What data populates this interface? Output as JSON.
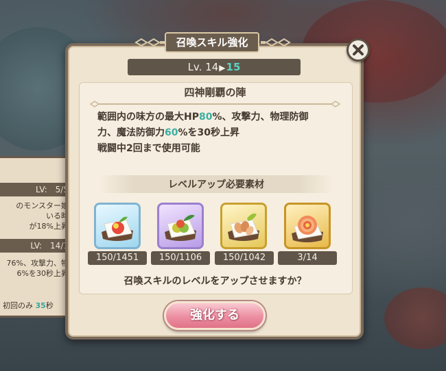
{
  "dialog": {
    "title": "召喚スキル強化",
    "level": {
      "prefix": "Lv.",
      "from": "14",
      "to": "15",
      "arrow": "▶"
    }
  },
  "skill": {
    "name": "四神剛覇の陣",
    "desc_line1_a": "範囲内の味方の最大HP",
    "desc_line1_val": "80",
    "desc_line1_b": "%、攻撃力、物理防御",
    "desc_line2_a": "力、魔法防御力",
    "desc_line2_val": "60",
    "desc_line2_b": "%を30秒上昇",
    "desc_line3": "戦闘中2回まで使用可能"
  },
  "materials": {
    "title": "レベルアップ必要素材",
    "items": [
      {
        "icon": "blue-fruit-toast-icon",
        "count": "150/1451"
      },
      {
        "icon": "purple-fruit-toast-icon",
        "count": "150/1106"
      },
      {
        "icon": "gold-nut-toast-icon",
        "count": "150/1042"
      },
      {
        "icon": "flower-toast-icon",
        "count": "3/14"
      }
    ]
  },
  "prompt": "召喚スキルのレベルをアップさせますか？",
  "button": {
    "label": "強化する"
  },
  "background_panel": {
    "lv1": "LV:　5/5",
    "text1": "のモンスター娘",
    "text2": "いる時",
    "text3": "が18%上昇",
    "lv2": "LV:　14/1",
    "text4": "76%、攻撃力、物",
    "text5": "6%を30秒上昇",
    "foot_label": "初回のみ",
    "foot_value": "35",
    "foot_unit": "秒"
  },
  "colors": {
    "accent_teal": "#3aaea2",
    "button_pink": "#ec8ea2",
    "panel_brown": "#5f5548"
  }
}
